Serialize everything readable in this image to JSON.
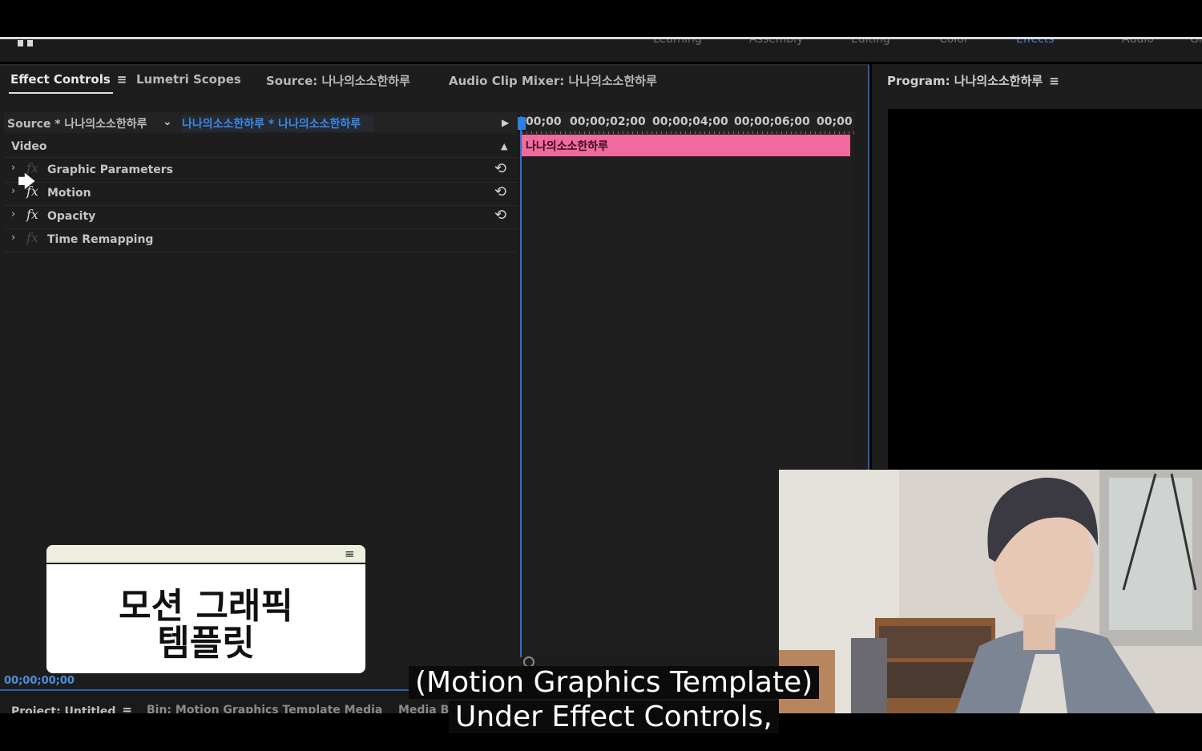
{
  "workspace_tabs": [
    "Learning",
    "Assembly",
    "Editing",
    "Color",
    "Effects",
    "Audio",
    "Gr"
  ],
  "panels": {
    "left_tabs": [
      {
        "label": "Effect Controls",
        "active": true
      },
      {
        "label": "Lumetri Scopes"
      },
      {
        "label": "Source: 나나의소소한하루"
      },
      {
        "label": "Audio Clip Mixer: 나나의소소한하루"
      }
    ],
    "program_tab": "Program: 나나의소소한하루"
  },
  "effect_controls": {
    "source_label": "Source * 나나의소소한하루",
    "sequence_label": "나나의소소한하루 * 나나의소소한하루",
    "section": "Video",
    "effects": [
      {
        "name": "Graphic Parameters",
        "fx_enabled": false,
        "reset": true
      },
      {
        "name": "Motion",
        "fx_enabled": true,
        "reset": true
      },
      {
        "name": "Opacity",
        "fx_enabled": true,
        "reset": true
      },
      {
        "name": "Time Remapping",
        "fx_enabled": false,
        "reset": false
      }
    ],
    "timecode": "00;00;00;00"
  },
  "timeline": {
    "ruler": [
      "00;00",
      "00;00;02;00",
      "00;00;04;00",
      "00;00;06;00",
      "00;00"
    ],
    "clip_label": "나나의소소한하루"
  },
  "bottom_tabs": [
    "Project: Untitled",
    "Bin: Motion Graphics Template Media",
    "Media Br"
  ],
  "overlay_card": {
    "line1": "모션 그래픽",
    "line2": "템플릿"
  },
  "subtitles": {
    "line1": "(Motion Graphics Template)",
    "line2": "Under Effect Controls,"
  },
  "colors": {
    "accent": "#2f7fe0",
    "clip": "#f06aa0",
    "panel_bg": "#1d1d1d"
  },
  "icons": {
    "menu": "≡",
    "reset": "⟲",
    "chevron": "›",
    "play": "▶",
    "collapse": "▲",
    "dropdown": "⌄"
  }
}
